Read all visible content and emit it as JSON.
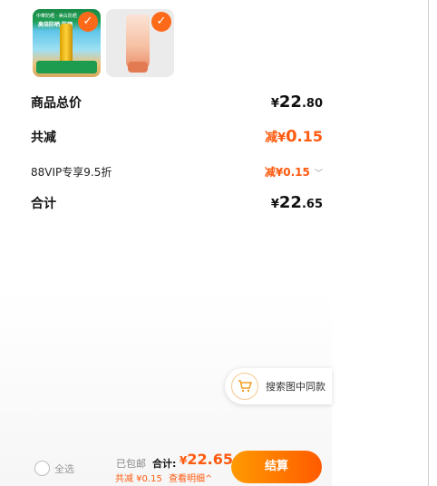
{
  "products": [
    {
      "name": "sunscreen-spray",
      "badge_top": "中華防晒 · 美白防晒",
      "title": "高倍防晒 防晒",
      "checked": true
    },
    {
      "name": "sunscreen-tube",
      "checked": true
    }
  ],
  "summary": {
    "goods_total_label": "商品总价",
    "goods_total": {
      "yen": "¥",
      "int": "22",
      "dec": ".80"
    },
    "discount_label": "共减",
    "discount_prefix": "减",
    "discount": {
      "yen": "¥",
      "int": "0",
      "dec": ".15"
    },
    "vip_label": "88VIP专享9.5折",
    "vip_value": "减¥0.15",
    "vip_chevron": "﹀",
    "subtotal_label": "合计",
    "subtotal": {
      "yen": "¥",
      "int": "22",
      "dec": ".65"
    }
  },
  "float_search": {
    "label": "搜索图中同款",
    "icon": "cart-icon"
  },
  "bottom_bar": {
    "select_all": "全选",
    "shipping": "已包邮",
    "total_label": "合计:",
    "total_yen": "¥",
    "total_value": "22.65",
    "save_text": "共减 ¥0.15",
    "detail_text": "查看明细^",
    "checkout": "结算"
  },
  "colors": {
    "accent": "#ff5a0f",
    "checkout_start": "#ff9a00",
    "checkout_end": "#ff5b00"
  }
}
